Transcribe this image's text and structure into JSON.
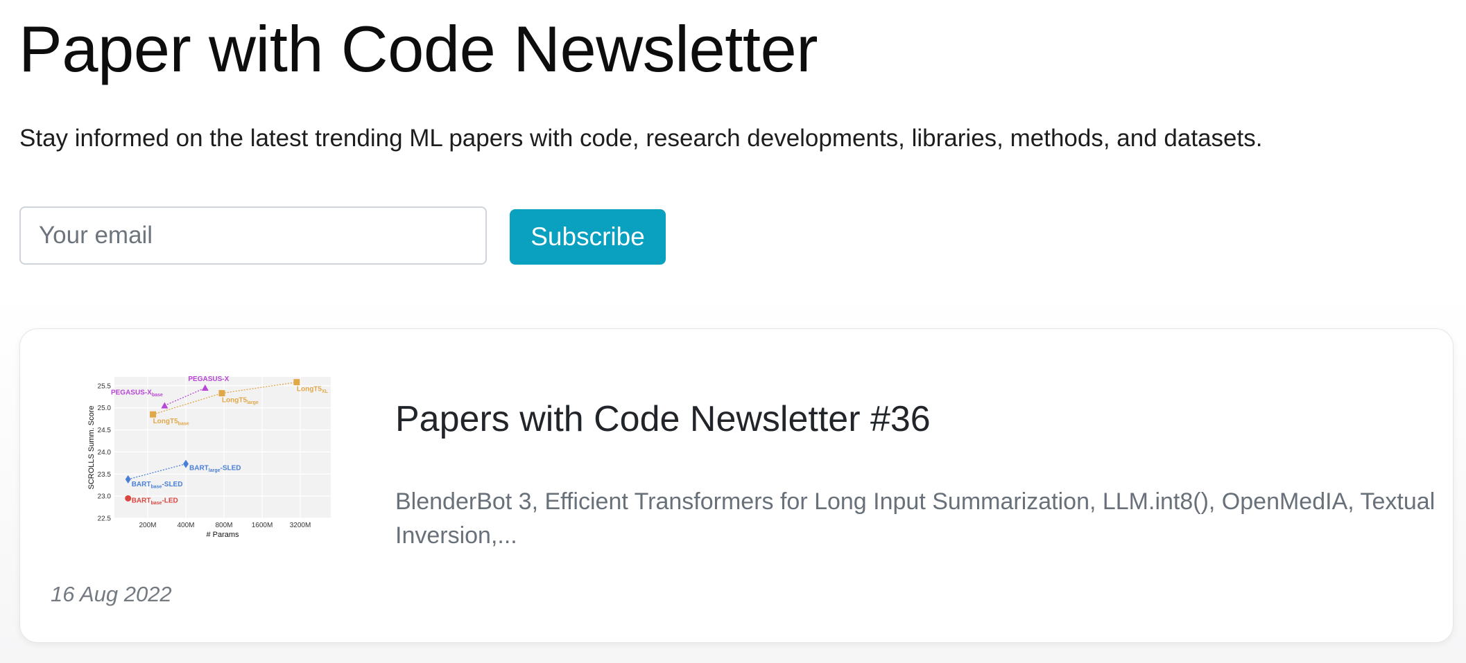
{
  "header": {
    "title": "Paper with Code Newsletter",
    "subtitle": "Stay informed on the latest trending ML papers with code, research developments, libraries, methods, and datasets."
  },
  "subscribe": {
    "email_placeholder": "Your email",
    "button_label": "Subscribe",
    "button_color": "#0aa0c0"
  },
  "post": {
    "title": "Papers with Code Newsletter #36",
    "description": "BlenderBot 3, Efficient Transformers for Long Input Summarization, LLM.int8(), OpenMedIA, Textual Inversion,...",
    "date": "16 Aug 2022",
    "thumbnail": {
      "chart_data": {
        "type": "scatter",
        "xlabel": "# Params",
        "ylabel": "SCROLLS Summ. Score",
        "x_ticks": [
          "200M",
          "400M",
          "800M",
          "1600M",
          "3200M"
        ],
        "y_ticks": [
          "22.5",
          "23.0",
          "23.5",
          "24.0",
          "24.5",
          "25.0",
          "25.5"
        ],
        "ylim": [
          22.5,
          25.7
        ],
        "grid": true,
        "series": [
          {
            "name": "PEGASUS-X",
            "color": "#b845d6",
            "marker": "triangle",
            "points": [
              {
                "x": "272M",
                "y": 25.05,
                "label": "PEGASUS-X",
                "sub": "base"
              },
              {
                "x": "568M",
                "y": 25.45,
                "label": "PEGASUS-X",
                "sub": ""
              }
            ]
          },
          {
            "name": "LongT5",
            "color": "#e0a848",
            "marker": "square",
            "points": [
              {
                "x": "220M",
                "y": 24.85,
                "label": "LongT5",
                "sub": "base"
              },
              {
                "x": "770M",
                "y": 25.33,
                "label": "LongT5",
                "sub": "large"
              },
              {
                "x": "3B",
                "y": 25.58,
                "label": "LongT5",
                "sub": "XL"
              }
            ]
          },
          {
            "name": "BART-SLED",
            "color": "#4a7fd8",
            "marker": "diamond",
            "points": [
              {
                "x": "140M",
                "y": 23.38,
                "label": "BART",
                "sub": "base",
                "suffix": "-SLED"
              },
              {
                "x": "400M",
                "y": 23.73,
                "label": "BART",
                "sub": "large",
                "suffix": "-SLED"
              }
            ]
          },
          {
            "name": "BART-LED",
            "color": "#d9463f",
            "marker": "circle",
            "points": [
              {
                "x": "140M",
                "y": 22.95,
                "label": "BART",
                "sub": "base",
                "suffix": "-LED"
              }
            ]
          }
        ]
      }
    }
  }
}
